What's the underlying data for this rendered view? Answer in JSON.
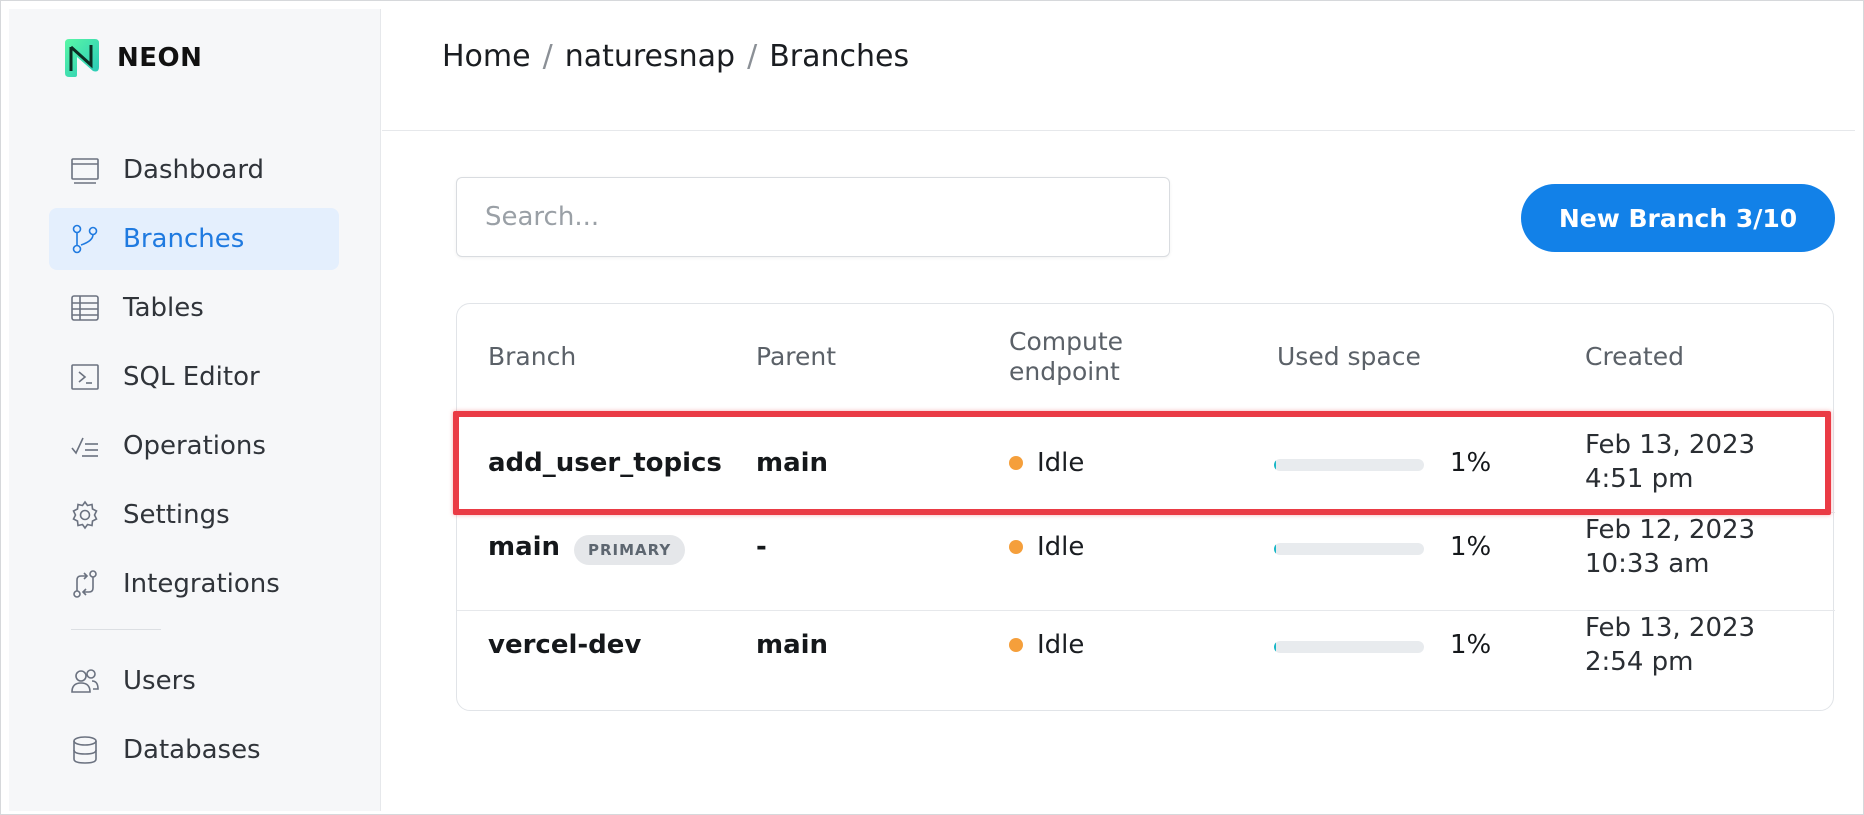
{
  "app": {
    "logo_text": "NEON",
    "accent": "#1281e8"
  },
  "sidebar": {
    "items": [
      {
        "label": "Dashboard",
        "icon": "dashboard-icon",
        "active": false
      },
      {
        "label": "Branches",
        "icon": "branches-icon",
        "active": true
      },
      {
        "label": "Tables",
        "icon": "tables-icon",
        "active": false
      },
      {
        "label": "SQL Editor",
        "icon": "sql-editor-icon",
        "active": false
      },
      {
        "label": "Operations",
        "icon": "operations-icon",
        "active": false
      },
      {
        "label": "Settings",
        "icon": "gear-icon",
        "active": false
      },
      {
        "label": "Integrations",
        "icon": "integrations-icon",
        "active": false
      }
    ],
    "secondary_items": [
      {
        "label": "Users",
        "icon": "users-icon"
      },
      {
        "label": "Databases",
        "icon": "database-icon"
      }
    ]
  },
  "breadcrumb": [
    "Home",
    "naturesnap",
    "Branches"
  ],
  "toolbar": {
    "search_placeholder": "Search...",
    "new_branch_label": "New Branch 3/10"
  },
  "table": {
    "columns": [
      "Branch",
      "Parent",
      "Compute\nendpoint",
      "Used space",
      "Created"
    ],
    "rows": [
      {
        "branch": "add_user_topics",
        "badge": "",
        "parent": "main",
        "status": "Idle",
        "used_pct": 1,
        "used_label": "1%",
        "created_date": "Feb 13, 2023",
        "created_time": "4:51 pm",
        "highlighted": true
      },
      {
        "branch": "main",
        "badge": "PRIMARY",
        "parent": "-",
        "status": "Idle",
        "used_pct": 1,
        "used_label": "1%",
        "created_date": "Feb 12, 2023",
        "created_time": "10:33 am",
        "highlighted": false
      },
      {
        "branch": "vercel-dev",
        "badge": "",
        "parent": "main",
        "status": "Idle",
        "used_pct": 1,
        "used_label": "1%",
        "created_date": "Feb 13, 2023",
        "created_time": "2:54 pm",
        "highlighted": false
      }
    ]
  },
  "colors": {
    "idle_status": "#f59f3b",
    "highlight": "#ea3b45",
    "usage_fill": "#19b7c7"
  }
}
